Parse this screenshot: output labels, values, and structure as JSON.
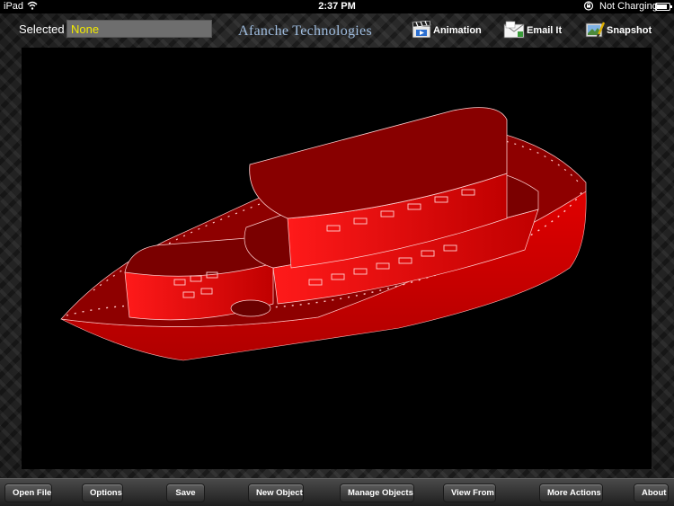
{
  "status_bar": {
    "carrier": "iPad",
    "time": "2:37 PM",
    "charging": "Not Charging",
    "battery_level": 0.85
  },
  "toolbar": {
    "selected_label": "Selected",
    "selected_value": "None",
    "brand": "Afanche Technologies",
    "animation_label": "Animation",
    "email_label": "Email It",
    "snapshot_label": "Snapshot"
  },
  "bottom_bar": {
    "open_file": "Open File",
    "options": "Options",
    "save": "Save",
    "new_object": "New Object",
    "manage_objects": "Manage Objects",
    "view_from": "View From",
    "more_actions": "More Actions",
    "about": "About"
  },
  "colors": {
    "model": "#d40000",
    "model_dark": "#8b0000",
    "selected_text": "#f2ea00",
    "brand": "#9fbde0"
  },
  "icons": [
    "wifi-icon",
    "lock-rotation-icon",
    "battery-icon",
    "clapperboard-icon",
    "envelope-icon",
    "camera-icon"
  ]
}
